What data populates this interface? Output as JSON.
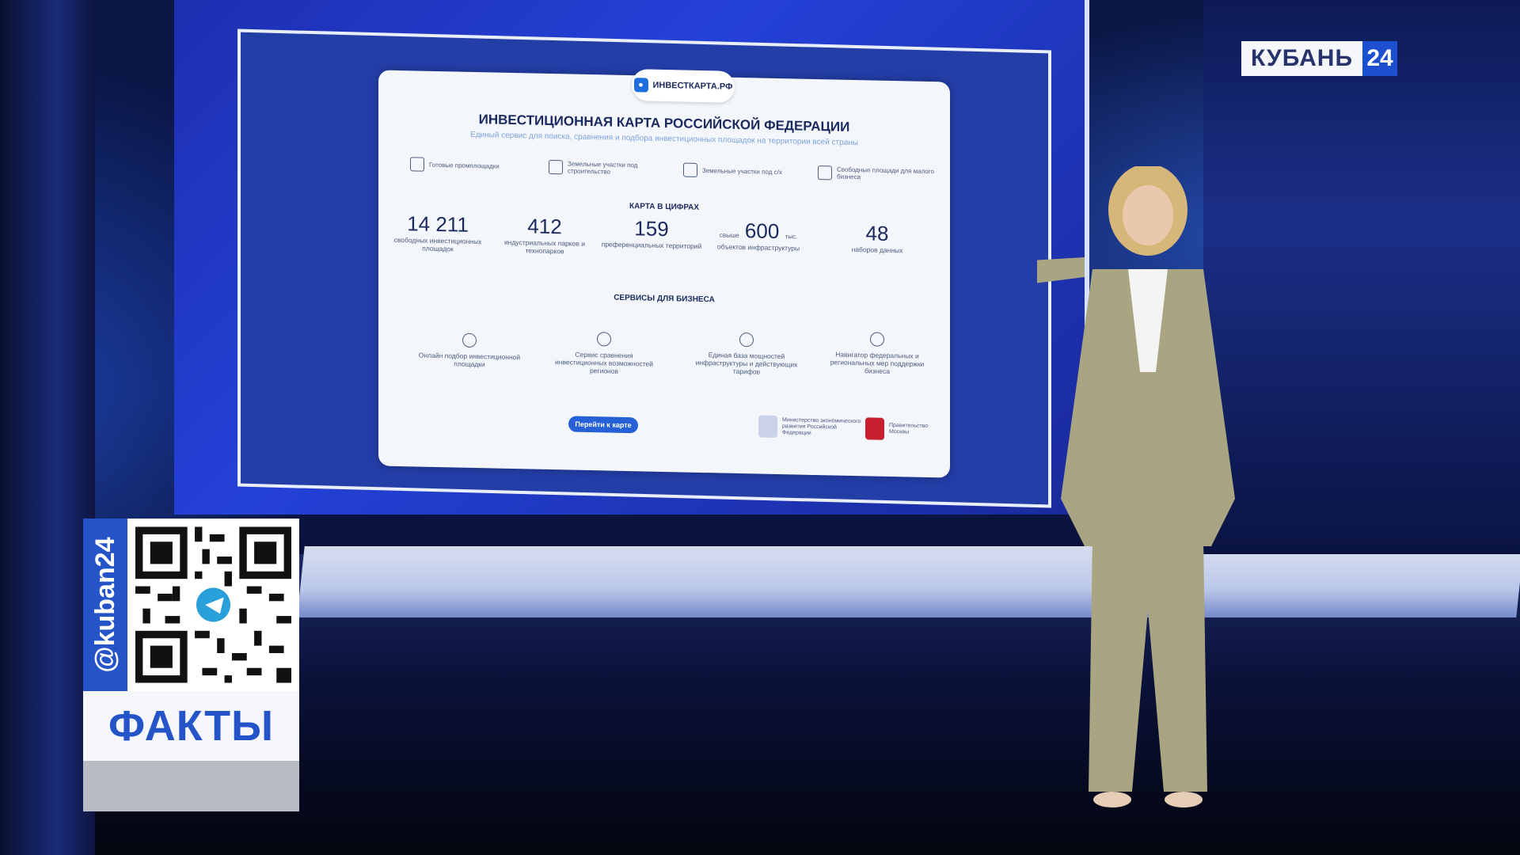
{
  "broadcast": {
    "channel_name": "КУБАНЬ",
    "channel_number": "24",
    "program": "ФАКТЫ",
    "telegram_handle": "@kuban24"
  },
  "screen": {
    "logo_text": "ИНВЕСТКАРТА.РФ",
    "title": "ИНВЕСТИЦИОННАЯ КАРТА РОССИЙСКОЙ ФЕДЕРАЦИИ",
    "subtitle": "Единый сервис для поиска, сравнения и подбора инвестиционных площадок на территории всей страны",
    "categories": [
      {
        "label": "Готовые промплощадки",
        "icon": "factory-icon"
      },
      {
        "label": "Земельные участки под строительство",
        "icon": "grid-icon"
      },
      {
        "label": "Земельные участки под с/х",
        "icon": "tractor-icon"
      },
      {
        "label": "Свободные площади для малого бизнеса",
        "icon": "building-icon"
      }
    ],
    "figures_title": "КАРТА В ЦИФРАХ",
    "figures": [
      {
        "pre": "",
        "number": "14 211",
        "post": "",
        "label": "свободных инвестиционных площадок"
      },
      {
        "pre": "",
        "number": "412",
        "post": "",
        "label": "индустриальных парков и технопарков"
      },
      {
        "pre": "",
        "number": "159",
        "post": "",
        "label": "преференциальных территорий"
      },
      {
        "pre": "свыше",
        "number": "600",
        "post": "тыс.",
        "label": "объектов инфраструктуры"
      },
      {
        "pre": "",
        "number": "48",
        "post": "",
        "label": "наборов данных"
      }
    ],
    "services_title": "СЕРВИСЫ ДЛЯ БИЗНЕСА",
    "services": [
      {
        "label": "Онлайн подбор инвестиционной площадки",
        "icon": "tower-icon"
      },
      {
        "label": "Сервис сравнения инвестиционных возможностей регионов",
        "icon": "chart-icon"
      },
      {
        "label": "Единая база мощностей инфраструктуры и действующих тарифов",
        "icon": "signal-icon"
      },
      {
        "label": "Навигатор федеральных и региональных мер поддержки бизнеса",
        "icon": "lifebuoy-icon"
      }
    ],
    "button_label": "Перейти к карте",
    "org_ministry": "Министерство экономического развития Российской Федерации",
    "org_moscow": "Правительство Москвы"
  },
  "colors": {
    "brand_blue": "#2554c9",
    "screen_blue": "#2441d8",
    "panel_bg": "#f3f6fb"
  }
}
